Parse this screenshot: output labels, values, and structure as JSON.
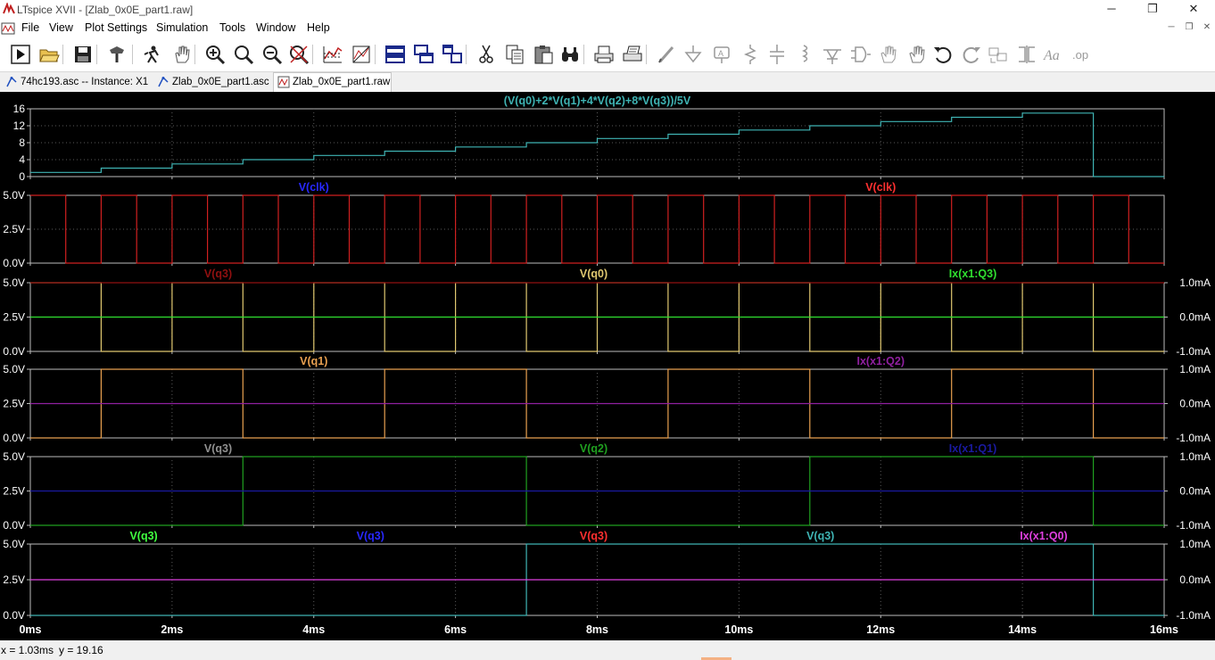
{
  "window": {
    "title": "LTspice XVII - [Zlab_0x0E_part1.raw]",
    "minimize": "─",
    "maximize": "❐",
    "close": "✕"
  },
  "menu": [
    "File",
    "View",
    "Plot Settings",
    "Simulation",
    "Tools",
    "Window",
    "Help"
  ],
  "tabs": [
    {
      "label": "74hc193.asc -- Instance: X1",
      "icon": "schematic-icon",
      "active": false
    },
    {
      "label": "Zlab_0x0E_part1.asc",
      "icon": "schematic-icon",
      "active": false
    },
    {
      "label": "Zlab_0x0E_part1.raw",
      "icon": "waveform-icon",
      "active": true
    }
  ],
  "toolbar": [
    "run-icon",
    "open-icon",
    "save-icon",
    "control-panel-icon",
    "halt-icon",
    "pan-icon",
    "zoom-in-icon",
    "zoom-area-icon",
    "zoom-out-icon",
    "zoom-fit-icon",
    "autorange-icon",
    "manual-limits-icon",
    "tile-horizontal-icon",
    "cascade-icon",
    "tile-vertical-icon",
    "cut-icon",
    "copy-icon",
    "paste-icon",
    "find-icon",
    "print-icon",
    "print-setup-icon",
    "draw-wire-icon",
    "ground-icon",
    "label-net-icon",
    "resistor-icon",
    "capacitor-icon",
    "inductor-icon",
    "diode-icon",
    "component-icon",
    "move-icon",
    "drag-icon",
    "undo-icon",
    "redo-icon",
    "rotate-icon",
    "mirror-icon",
    "text-icon",
    "spice-directive-icon"
  ],
  "plot": {
    "background": "#000000",
    "grid_color": "#5a5a5a",
    "x_axis": {
      "ticks": [
        "0ms",
        "2ms",
        "4ms",
        "6ms",
        "8ms",
        "10ms",
        "12ms",
        "14ms",
        "16ms"
      ],
      "range_ms": [
        0,
        16
      ]
    },
    "panes": [
      {
        "left_ticks": [
          "16",
          "12",
          "8",
          "4",
          "0"
        ],
        "right_ticks": [],
        "labels": [
          {
            "text": "(V(q0)+2*V(q1)+4*V(q2)+8*V(q3))/5V",
            "color": "#3fb4b4",
            "at_ms": 8.0
          }
        ]
      },
      {
        "left_ticks": [
          "5.0V",
          "2.5V",
          "0.0V"
        ],
        "right_ticks": [],
        "labels": [
          {
            "text": "V(clk)",
            "color": "#2828ff",
            "at_ms": 4.0
          },
          {
            "text": "V(clk)",
            "color": "#ff3030",
            "at_ms": 12.0
          }
        ]
      },
      {
        "left_ticks": [
          "5.0V",
          "2.5V",
          "0.0V"
        ],
        "right_ticks": [
          "1.0mA",
          "0.0mA",
          "-1.0mA"
        ],
        "labels": [
          {
            "text": "V(q3)",
            "color": "#901010",
            "at_ms": 2.65
          },
          {
            "text": "V(q0)",
            "color": "#e0c870",
            "at_ms": 7.95
          },
          {
            "text": "Ix(x1:Q3)",
            "color": "#30e030",
            "at_ms": 13.3
          }
        ]
      },
      {
        "left_ticks": [
          "5.0V",
          "2.5V",
          "0.0V"
        ],
        "right_ticks": [
          "1.0mA",
          "0.0mA",
          "-1.0mA"
        ],
        "labels": [
          {
            "text": "V(q1)",
            "color": "#e8a050",
            "at_ms": 4.0
          },
          {
            "text": "Ix(x1:Q2)",
            "color": "#9020a0",
            "at_ms": 12.0
          }
        ]
      },
      {
        "left_ticks": [
          "5.0V",
          "2.5V",
          "0.0V"
        ],
        "right_ticks": [
          "1.0mA",
          "0.0mA",
          "-1.0mA"
        ],
        "labels": [
          {
            "text": "V(q3)",
            "color": "#909090",
            "at_ms": 2.65
          },
          {
            "text": "V(q2)",
            "color": "#20a020",
            "at_ms": 7.95
          },
          {
            "text": "Ix(x1:Q1)",
            "color": "#1a1aa0",
            "at_ms": 13.3
          }
        ]
      },
      {
        "left_ticks": [
          "5.0V",
          "2.5V",
          "0.0V"
        ],
        "right_ticks": [
          "1.0mA",
          "0.0mA",
          "-1.0mA"
        ],
        "labels": [
          {
            "text": "V(q3)",
            "color": "#40ff40",
            "at_ms": 1.6
          },
          {
            "text": "V(q3)",
            "color": "#2828ff",
            "at_ms": 4.8
          },
          {
            "text": "V(q3)",
            "color": "#ff3030",
            "at_ms": 7.95
          },
          {
            "text": "V(q3)",
            "color": "#3fb4b4",
            "at_ms": 11.15
          },
          {
            "text": "Ix(x1:Q0)",
            "color": "#e040e0",
            "at_ms": 14.3
          }
        ]
      }
    ]
  },
  "chart_data": [
    {
      "type": "line",
      "title": "(V(q0)+2*V(q1)+4*V(q2)+8*V(q3))/5V",
      "xlabel": "",
      "ylabel": "",
      "xlim": [
        0,
        16
      ],
      "ylim": [
        0,
        16
      ],
      "grid": true,
      "series": [
        {
          "name": "(V(q0)+2*V(q1)+4*V(q2)+8*V(q3))/5V",
          "color": "#3fb4b4",
          "step": true,
          "x": [
            0,
            1,
            1,
            2,
            2,
            3,
            3,
            4,
            4,
            5,
            5,
            6,
            6,
            7,
            7,
            8,
            8,
            9,
            9,
            10,
            10,
            11,
            11,
            12,
            12,
            13,
            13,
            14,
            14,
            15,
            15,
            16
          ],
          "y": [
            1,
            1,
            2,
            2,
            3,
            3,
            4,
            4,
            5,
            5,
            6,
            6,
            7,
            7,
            8,
            8,
            9,
            9,
            10,
            10,
            11,
            11,
            12,
            12,
            13,
            13,
            14,
            14,
            15,
            15,
            0,
            0
          ]
        }
      ]
    },
    {
      "type": "line",
      "title": "V(clk)",
      "xlabel": "",
      "ylabel": "",
      "xlim": [
        0,
        16
      ],
      "ylim": [
        0,
        5
      ],
      "grid": true,
      "series": [
        {
          "name": "V(clk)",
          "color": "#d02020",
          "step": true,
          "x": [
            0,
            0.5,
            0.5,
            1,
            1,
            1.5,
            1.5,
            2,
            2,
            2.5,
            2.5,
            3,
            3,
            3.5,
            3.5,
            4,
            4,
            4.5,
            4.5,
            5,
            5,
            5.5,
            5.5,
            6,
            6,
            6.5,
            6.5,
            7,
            7,
            7.5,
            7.5,
            8,
            8,
            8.5,
            8.5,
            9,
            9,
            9.5,
            9.5,
            10,
            10,
            10.5,
            10.5,
            11,
            11,
            11.5,
            11.5,
            12,
            12,
            12.5,
            12.5,
            13,
            13,
            13.5,
            13.5,
            14,
            14,
            14.5,
            14.5,
            15,
            15,
            15.5,
            15.5,
            16
          ],
          "y": [
            5,
            5,
            0,
            0,
            5,
            5,
            0,
            0,
            5,
            5,
            0,
            0,
            5,
            5,
            0,
            0,
            5,
            5,
            0,
            0,
            5,
            5,
            0,
            0,
            5,
            5,
            0,
            0,
            5,
            5,
            0,
            0,
            5,
            5,
            0,
            0,
            5,
            5,
            0,
            0,
            5,
            5,
            0,
            0,
            5,
            5,
            0,
            0,
            5,
            5,
            0,
            0,
            5,
            5,
            0,
            0,
            5,
            5,
            0,
            0,
            5,
            5,
            0,
            0
          ]
        }
      ]
    },
    {
      "type": "line",
      "title": "V(q0)",
      "xlabel": "",
      "ylabel": "",
      "xlim": [
        0,
        16
      ],
      "ylim": [
        0,
        5
      ],
      "grid": true,
      "series": [
        {
          "name": "V(q0)",
          "color": "#e0c870",
          "step": true,
          "x": [
            0,
            1,
            1,
            2,
            2,
            3,
            3,
            4,
            4,
            5,
            5,
            6,
            6,
            7,
            7,
            8,
            8,
            9,
            9,
            10,
            10,
            11,
            11,
            12,
            12,
            13,
            13,
            14,
            14,
            15,
            15,
            16
          ],
          "y": [
            5,
            5,
            0,
            0,
            5,
            5,
            0,
            0,
            5,
            5,
            0,
            0,
            5,
            5,
            0,
            0,
            5,
            5,
            0,
            0,
            5,
            5,
            0,
            0,
            5,
            5,
            0,
            0,
            5,
            5,
            0,
            0
          ]
        },
        {
          "name": "Ix(x1:Q3)",
          "color": "#30e030",
          "x": [
            0,
            16
          ],
          "y": [
            2.5,
            2.5
          ]
        },
        {
          "name": "V(q3)",
          "color": "#901010",
          "x": [
            0,
            16
          ],
          "y": [
            5,
            5
          ]
        }
      ]
    },
    {
      "type": "line",
      "title": "V(q1)",
      "xlabel": "",
      "ylabel": "",
      "xlim": [
        0,
        16
      ],
      "ylim": [
        0,
        5
      ],
      "grid": true,
      "series": [
        {
          "name": "V(q1)",
          "color": "#e8a050",
          "step": true,
          "x": [
            0,
            1,
            1,
            3,
            3,
            5,
            5,
            7,
            7,
            9,
            9,
            11,
            11,
            13,
            13,
            15,
            15,
            16
          ],
          "y": [
            0,
            0,
            5,
            5,
            0,
            0,
            5,
            5,
            0,
            0,
            5,
            5,
            0,
            0,
            5,
            5,
            0,
            0
          ]
        },
        {
          "name": "Ix(x1:Q2)",
          "color": "#9020a0",
          "x": [
            0,
            16
          ],
          "y": [
            2.5,
            2.5
          ]
        }
      ]
    },
    {
      "type": "line",
      "title": "V(q2)",
      "xlabel": "",
      "ylabel": "",
      "xlim": [
        0,
        16
      ],
      "ylim": [
        0,
        5
      ],
      "grid": true,
      "series": [
        {
          "name": "V(q2)",
          "color": "#20a020",
          "step": true,
          "x": [
            0,
            3,
            3,
            7,
            7,
            11,
            11,
            15,
            15,
            16
          ],
          "y": [
            0,
            0,
            5,
            5,
            0,
            0,
            5,
            5,
            0,
            0
          ]
        },
        {
          "name": "Ix(x1:Q1)",
          "color": "#1a1aa0",
          "x": [
            0,
            16
          ],
          "y": [
            2.5,
            2.5
          ]
        }
      ]
    },
    {
      "type": "line",
      "title": "V(q3)",
      "xlabel": "",
      "ylabel": "",
      "xlim": [
        0,
        16
      ],
      "ylim": [
        0,
        5
      ],
      "grid": true,
      "series": [
        {
          "name": "V(q3)",
          "color": "#3fb4b4",
          "step": true,
          "x": [
            0,
            7,
            7,
            15,
            15,
            16
          ],
          "y": [
            0,
            0,
            5,
            5,
            0,
            0
          ]
        },
        {
          "name": "Ix(x1:Q0)",
          "color": "#e040e0",
          "x": [
            0,
            16
          ],
          "y": [
            2.5,
            2.5
          ]
        }
      ]
    }
  ],
  "status": {
    "cursor_x": "x = 1.03ms",
    "cursor_y": "y = 19.16"
  }
}
